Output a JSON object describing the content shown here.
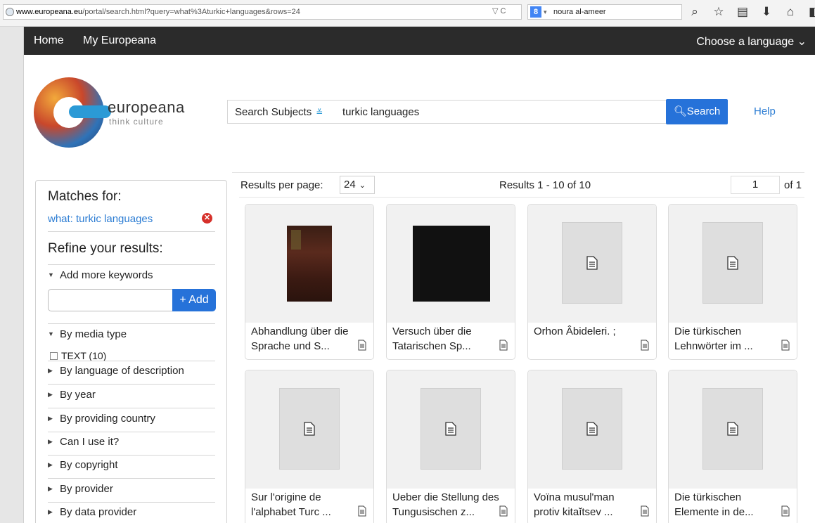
{
  "browser": {
    "url_domain": "www.europeana.eu",
    "url_path": "/portal/search.html?query=what%3Aturkic+languages&rows=24",
    "url_controls": "▽ C",
    "search_badge": "8",
    "search_text": "noura al-ameer",
    "toolbar_icons": [
      "search-icon",
      "star-icon",
      "bookmarks-icon",
      "download-icon",
      "home-icon",
      "extension-icon"
    ]
  },
  "nav": {
    "home": "Home",
    "my_europeana": "My Europeana",
    "language": "Choose a language ⌄"
  },
  "logo": {
    "name": "europeana",
    "tagline": "think culture"
  },
  "search": {
    "subjects_label": "Search Subjects",
    "query": "turkic languages",
    "button": "Search",
    "help": "Help"
  },
  "sidebar": {
    "matches_heading": "Matches for:",
    "match_term": "what: turkic languages",
    "refine_heading": "Refine your results:",
    "add_keywords": "Add more keywords",
    "add_button": "+ Add",
    "media_type": "By media type",
    "text_filter": "TEXT (10)",
    "facets": [
      "By language of description",
      "By year",
      "By providing country",
      "Can I use it?",
      "By copyright",
      "By provider",
      "By data provider"
    ]
  },
  "results": {
    "per_page_label": "Results per page:",
    "per_page_value": "24",
    "count_text": "Results  1 - 10 of 10",
    "page_value": "1",
    "page_of": "of 1",
    "items": [
      {
        "l1": "Abhandlung über die",
        "l2": "Sprache und S..."
      },
      {
        "l1": "Versuch über die",
        "l2": "Tatarischen Sp..."
      },
      {
        "l1": "Orhon Âbideleri. ;",
        "l2": ""
      },
      {
        "l1": "Die türkischen",
        "l2": "Lehnwörter im ..."
      },
      {
        "l1": "Sur l'origine de",
        "l2": "l'alphabet Turc ..."
      },
      {
        "l1": "Ueber die Stellung des",
        "l2": "Tungusischen z..."
      },
      {
        "l1": "Voïna musul'man",
        "l2": "protiv kitaĭtsev ..."
      },
      {
        "l1": "Die türkischen",
        "l2": "Elemente in de..."
      }
    ]
  }
}
